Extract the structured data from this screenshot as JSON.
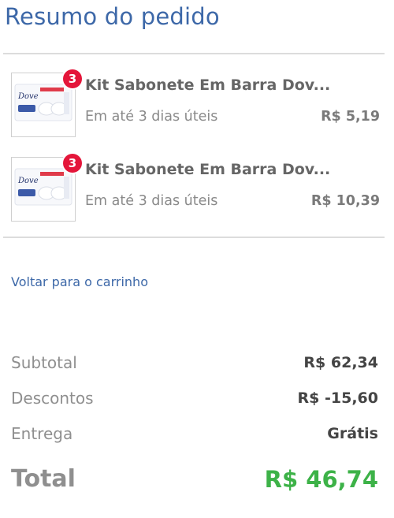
{
  "header": {
    "title": "Resumo do pedido"
  },
  "items": [
    {
      "name": "Kit Sabonete Em Barra Dov...",
      "quantity": "3",
      "delivery": "Em até 3 dias úteis",
      "price": "R$ 5,19",
      "brand": "Dove"
    },
    {
      "name": "Kit Sabonete Em Barra Dov...",
      "quantity": "3",
      "delivery": "Em até 3 dias úteis",
      "price": "R$ 10,39",
      "brand": "Dove"
    }
  ],
  "back_link": "Voltar para o carrinho",
  "summary": {
    "subtotal_label": "Subtotal",
    "subtotal_value": "R$ 62,34",
    "discounts_label": "Descontos",
    "discounts_value": "R$ -15,60",
    "delivery_label": "Entrega",
    "delivery_value": "Grátis",
    "total_label": "Total",
    "total_value": "R$ 46,74"
  },
  "colors": {
    "title": "#3d68a8",
    "badge": "#e4163a",
    "total": "#3db248",
    "link": "#3d68a8"
  }
}
